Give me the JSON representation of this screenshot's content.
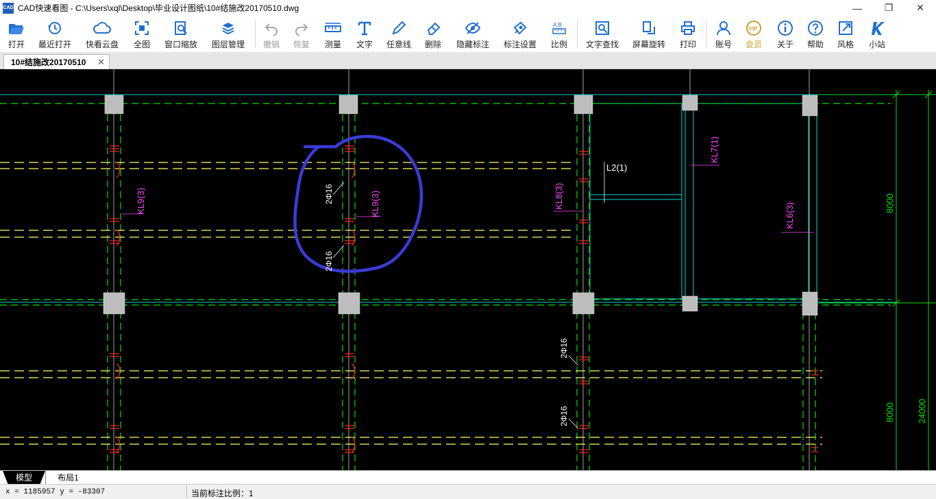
{
  "window": {
    "app_icon_text": "CAD",
    "title": "CAD快速看图 - C:\\Users\\xql\\Desktop\\毕业设计图纸\\10#结施改20170510.dwg",
    "minimize": "—",
    "maximize": "❐",
    "close": "✕"
  },
  "toolbar": {
    "items": [
      {
        "label": "打开",
        "icon": "folder-open-icon"
      },
      {
        "label": "最近打开",
        "icon": "history-icon"
      },
      {
        "label": "快看云盘",
        "icon": "cloud-icon"
      },
      {
        "label": "全图",
        "icon": "fullview-icon"
      },
      {
        "label": "窗口缩放",
        "icon": "zoom-window-icon"
      },
      {
        "label": "图层管理",
        "icon": "layers-icon"
      },
      {
        "label": "撤销",
        "icon": "undo-icon",
        "disabled": true
      },
      {
        "label": "恢复",
        "icon": "redo-icon",
        "disabled": true
      },
      {
        "label": "测量",
        "icon": "ruler-icon"
      },
      {
        "label": "文字",
        "icon": "text-icon"
      },
      {
        "label": "任意线",
        "icon": "pen-icon"
      },
      {
        "label": "删除",
        "icon": "eraser-icon"
      },
      {
        "label": "隐藏标注",
        "icon": "eye-hide-icon"
      },
      {
        "label": "标注设置",
        "icon": "dim-settings-icon"
      },
      {
        "label": "比例",
        "icon": "scale-icon"
      },
      {
        "label": "文字查找",
        "icon": "text-search-icon"
      },
      {
        "label": "屏幕旋转",
        "icon": "rotate-screen-icon"
      },
      {
        "label": "打印",
        "icon": "printer-icon"
      },
      {
        "label": "账号",
        "icon": "user-icon"
      },
      {
        "label": "会员",
        "icon": "vip-icon",
        "vip": true
      },
      {
        "label": "关于",
        "icon": "info-icon"
      },
      {
        "label": "帮助",
        "icon": "help-icon"
      },
      {
        "label": "风格",
        "icon": "style-icon"
      },
      {
        "label": "小站",
        "icon": "k-site-icon"
      }
    ]
  },
  "document_tab": {
    "title": "10#结施改20170510",
    "close": "✕"
  },
  "drawing": {
    "beam_labels": [
      "KL9(3)",
      "KL9(3)",
      "KL8(3)",
      "L2(1)",
      "KL7(1)",
      "KL6(3)"
    ],
    "rebar_labels": [
      "2Φ16",
      "2Φ16",
      "2Φ16",
      "2Φ16"
    ],
    "dimensions": [
      "8000",
      "8000",
      "24000"
    ],
    "colors": {
      "background": "#000000",
      "axis": "#00e000",
      "beam": "#ffff66",
      "label": "#ff44ff",
      "annotation_circle": "#3b3bd8",
      "column": "#c0c0c0",
      "rebar": "#ff2020"
    }
  },
  "layout_tabs": {
    "model": "模型",
    "layout1": "布局1"
  },
  "status": {
    "coords": "x = 1185957  y = -83307",
    "scale_text": "当前标注比例：1"
  }
}
